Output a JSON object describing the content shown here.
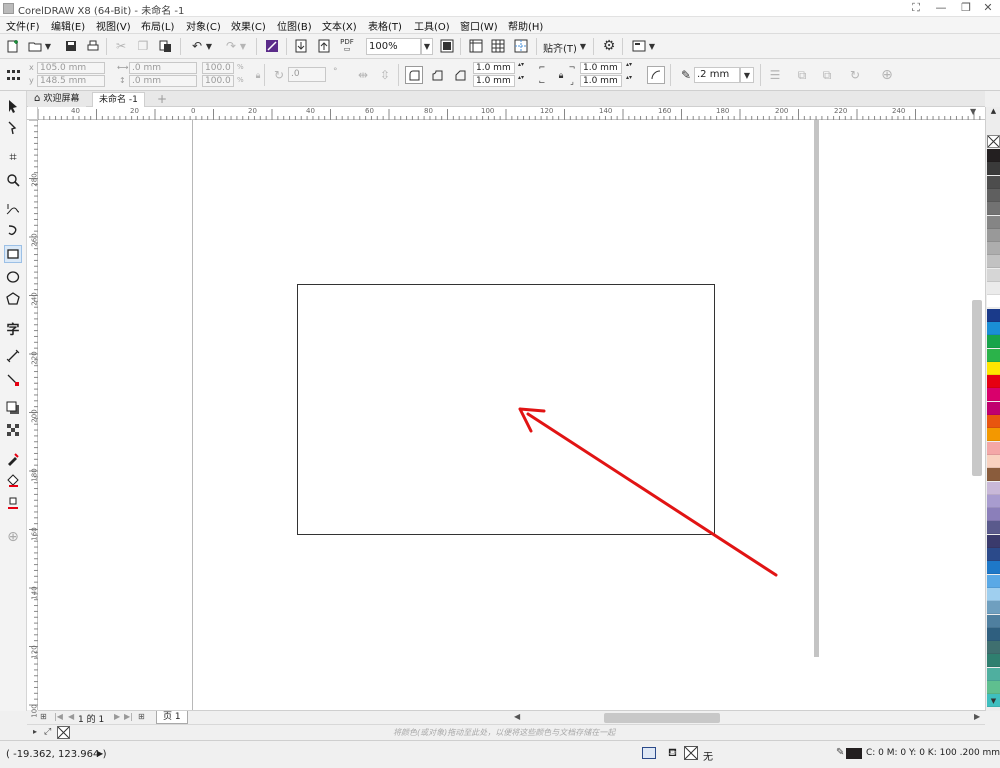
{
  "window": {
    "title": "CorelDRAW X8 (64-Bit) - 未命名 -1",
    "controls": [
      "⛶",
      "—",
      "❐",
      "✕"
    ]
  },
  "menus": [
    "文件(F)",
    "编辑(E)",
    "视图(V)",
    "布局(L)",
    "对象(C)",
    "效果(C)",
    "位图(B)",
    "文本(X)",
    "表格(T)",
    "工具(O)",
    "窗口(W)",
    "帮助(H)"
  ],
  "toolbar": {
    "pdf_label": "PDF",
    "zoom": "100%",
    "snap_label": "贴齐(T)"
  },
  "property_bar": {
    "x": "105.0 mm",
    "y": "148.5 mm",
    "width": ".0 mm",
    "height": ".0 mm",
    "scale_x": "100.0",
    "scale_y": "100.0",
    "percent": "%",
    "rotation": ".0",
    "rotation_unit": "°",
    "corner_radius_1": "1.0 mm",
    "corner_radius_2": "1.0 mm",
    "corner_radius_3": "1.0 mm",
    "corner_radius_4": "1.0 mm",
    "outline_width": ".2 mm"
  },
  "tabs": [
    {
      "label": "欢迎屏幕"
    },
    {
      "label": "未命名 -1"
    }
  ],
  "ruler": {
    "h_labels": [
      "40",
      "20",
      "0",
      "20",
      "40",
      "60",
      "80",
      "100",
      "120",
      "140",
      "160",
      "180",
      "200",
      "220",
      "240"
    ],
    "v_labels": [
      "280",
      "260",
      "240",
      "220",
      "200",
      "180",
      "160",
      "140",
      "120",
      "100"
    ]
  },
  "page_nav": {
    "page_count": "1 的 1",
    "page_tab": "页 1"
  },
  "color_bar_hint": "将颜色(或对象)拖动至此处，以便将这些颜色与文档存储在一起",
  "status": {
    "coords": "( -19.362, 123.964 )",
    "fill_label": "无",
    "outline_info": "C: 0 M: 0 Y: 0 K: 100  .200 mm"
  },
  "palette": [
    "#231f20",
    "#3a3a3a",
    "#4d4d4d",
    "#5f5f5f",
    "#727272",
    "#858585",
    "#999999",
    "#adadad",
    "#c2c2c2",
    "#d6d6d6",
    "#ebebeb",
    "#ffffff",
    "#1a3a8a",
    "#1a8fd6",
    "#17a44b",
    "#2bb34a",
    "#ffe600",
    "#e60012",
    "#d9006c",
    "#c0006f",
    "#e8550f",
    "#f39800",
    "#f4a7a7",
    "#f9d2c0",
    "#8a5c3c",
    "#c8b8d8",
    "#a89ccf",
    "#8b7fba",
    "#5a5a8c",
    "#3a3a6c",
    "#2b4a8a",
    "#1e78c8",
    "#5aa9e6",
    "#9fcfef",
    "#6f9fbf",
    "#4f7f9f",
    "#2f5f7f",
    "#3f6f6f",
    "#2f7f6f",
    "#4faf9f",
    "#5fbf8f",
    "#3fbfbf"
  ],
  "colors": {
    "arrow": "#e11414",
    "accent": "#4a90d9"
  }
}
